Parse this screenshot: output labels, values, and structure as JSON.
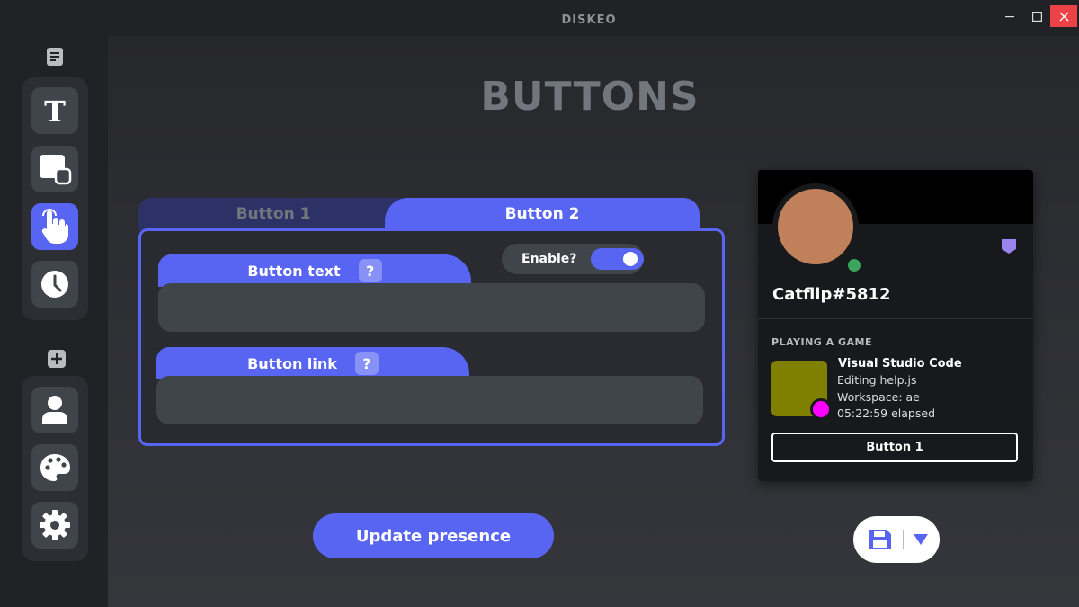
{
  "window": {
    "title": "DISKEO",
    "minimize_glyph": "—",
    "maximize_glyph": "☐",
    "close_glyph": "✕"
  },
  "sidebar": {
    "top_icon": "text-document-icon",
    "group1": [
      {
        "icon": "text-format-icon",
        "glyph": "T",
        "active": false
      },
      {
        "icon": "images-icon",
        "active": false
      },
      {
        "icon": "pointer-hand-icon",
        "active": true
      },
      {
        "icon": "clock-icon",
        "active": false
      }
    ],
    "add_icon": "plus-icon",
    "group2": [
      {
        "icon": "user-icon",
        "active": false
      },
      {
        "icon": "palette-icon",
        "active": false
      },
      {
        "icon": "gear-icon",
        "active": false
      }
    ]
  },
  "page": {
    "title": "BUTTONS"
  },
  "tabs": [
    {
      "label": "Button 1",
      "active": false
    },
    {
      "label": "Button 2",
      "active": true
    }
  ],
  "form": {
    "enable_label": "Enable?",
    "enabled": true,
    "button_text": {
      "label": "Button text",
      "help": "?",
      "value": ""
    },
    "button_link": {
      "label": "Button link",
      "help": "?",
      "value": ""
    }
  },
  "actions": {
    "update_label": "Update presence",
    "save_icon": "save-icon",
    "dropdown_icon": "dropdown-arrow-icon"
  },
  "profile": {
    "username": "Catflip#5812",
    "status": "online",
    "activity_label": "PLAYING A GAME",
    "game_name": "Visual Studio Code",
    "details": "Editing help.js",
    "state": "Workspace: ae",
    "elapsed": "05:22:59 elapsed",
    "button_label": "Button 1"
  },
  "colors": {
    "accent": "#5865f2",
    "background": "#212226",
    "card": "#18191c",
    "online": "#3ba55d",
    "large_image": "#808000",
    "small_image": "#ff00ff",
    "badge": "#9b84ee"
  }
}
